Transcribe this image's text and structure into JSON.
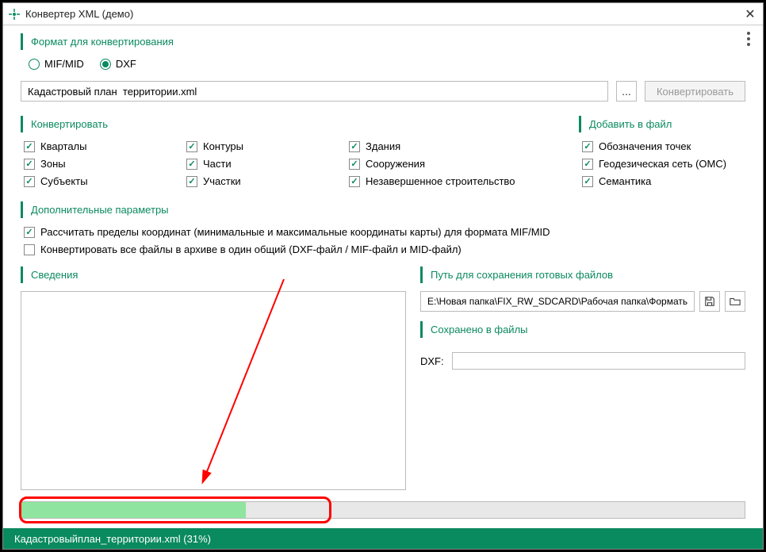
{
  "window": {
    "title": "Конвертер XML (демо)"
  },
  "sections": {
    "format": "Формат для конвертирования",
    "convert": "Конвертировать",
    "addfile": "Добавить в файл",
    "params": "Дополнительные параметры",
    "info": "Сведения",
    "savepath": "Путь для сохранения готовых файлов",
    "saved": "Сохранено в файлы"
  },
  "radios": {
    "mif": "MIF/MID",
    "dxf": "DXF"
  },
  "file": {
    "value": "Кадастровый план  территории.xml",
    "browse": "...",
    "convert_btn": "Конвертировать"
  },
  "checkboxes": {
    "convert": [
      {
        "label": "Кварталы",
        "checked": true
      },
      {
        "label": "Контуры",
        "checked": true
      },
      {
        "label": "Здания",
        "checked": true
      },
      {
        "label": "Зоны",
        "checked": true
      },
      {
        "label": "Части",
        "checked": true
      },
      {
        "label": "Сооружения",
        "checked": true
      },
      {
        "label": "Субъекты",
        "checked": true
      },
      {
        "label": "Участки",
        "checked": true
      },
      {
        "label": "Незавершенное строительство",
        "checked": true
      }
    ],
    "addfile": [
      {
        "label": "Обозначения точек",
        "checked": true
      },
      {
        "label": "Геодезическая сеть (ОМС)",
        "checked": true
      },
      {
        "label": "Семантика",
        "checked": true
      }
    ],
    "params": [
      {
        "label": "Рассчитать пределы координат (минимальные и максимальные координаты карты) для формата MIF/MID",
        "checked": true
      },
      {
        "label": "Конвертировать все файлы в архиве в один общий (DXF-файл / MIF-файл и MID-файл)",
        "checked": false
      }
    ]
  },
  "path": {
    "value": "E:\\Новая папка\\FIX_RW_SDCARD\\Рабочая папка\\Форматы файло"
  },
  "dxf": {
    "label": "DXF:",
    "value": ""
  },
  "progress": {
    "percent": 31
  },
  "status": {
    "text": "Кадастровыйплан_территории.xml (31%)"
  }
}
